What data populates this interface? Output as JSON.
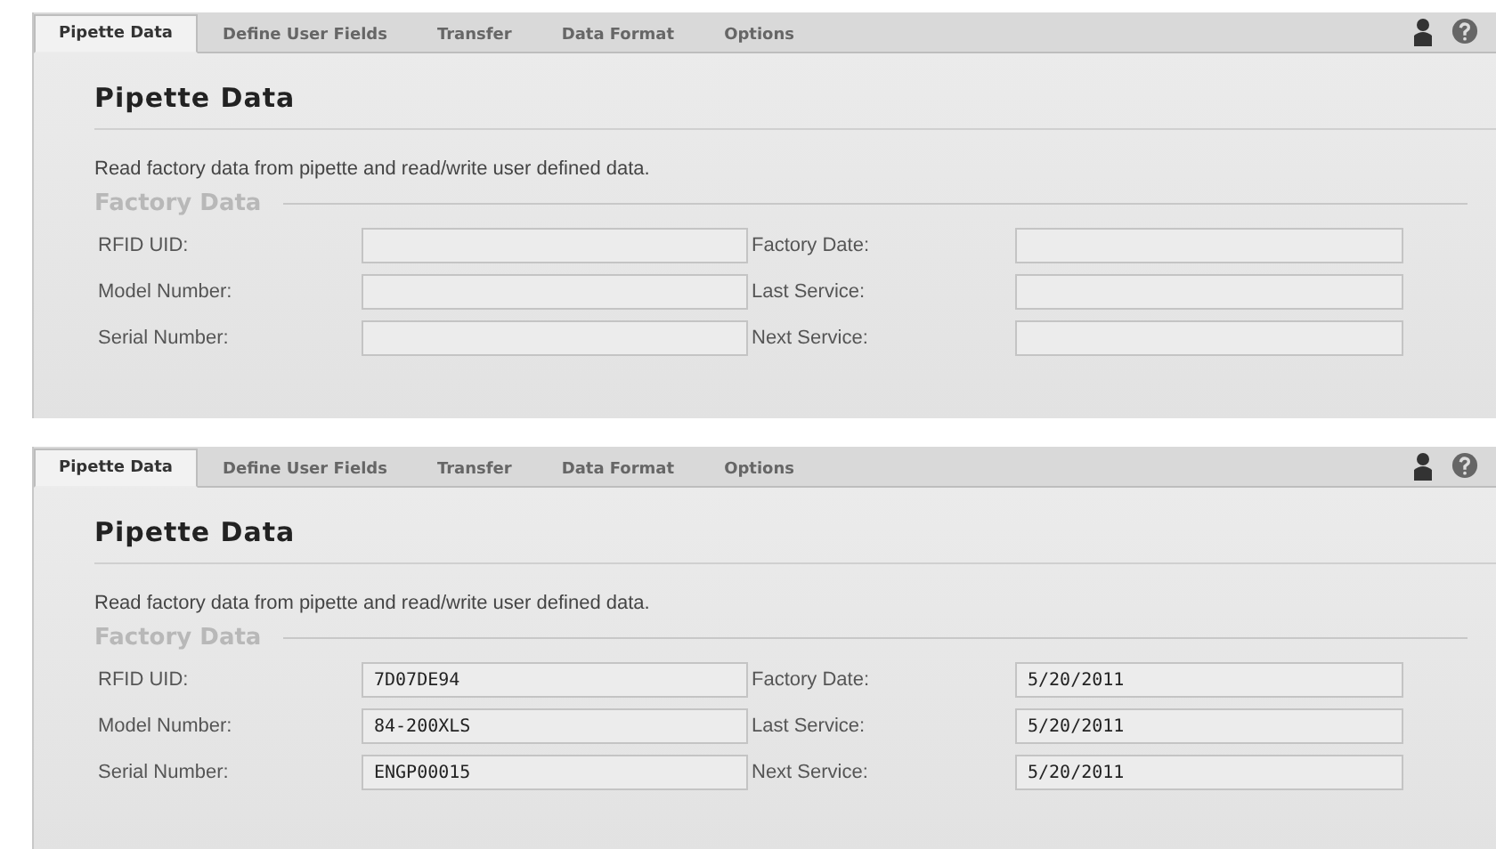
{
  "panels": [
    {
      "tabs": [
        {
          "label": "Pipette Data",
          "selected": true
        },
        {
          "label": "Define User Fields",
          "selected": false
        },
        {
          "label": "Transfer",
          "selected": false
        },
        {
          "label": "Data Format",
          "selected": false
        },
        {
          "label": "Options",
          "selected": false
        }
      ],
      "title": "Pipette Data",
      "description": "Read factory data from pipette and read/write user defined data.",
      "section": "Factory Data",
      "fields": [
        {
          "label": "RFID UID:"
        },
        {
          "label": "Factory Date:"
        },
        {
          "label": "Model Number:"
        },
        {
          "label": "Last Service:"
        },
        {
          "label": "Serial Number:"
        },
        {
          "label": "Next Service:"
        }
      ]
    },
    {
      "tabs": [
        {
          "label": "Pipette Data",
          "selected": true
        },
        {
          "label": "Define User Fields",
          "selected": false
        },
        {
          "label": "Transfer",
          "selected": false
        },
        {
          "label": "Data Format",
          "selected": false
        },
        {
          "label": "Options",
          "selected": false
        }
      ],
      "title": "Pipette Data",
      "description": "Read factory data from pipette and read/write user defined data.",
      "section": "Factory Data",
      "fields": [
        {
          "label": "RFID UID:",
          "value": "7D07DE94"
        },
        {
          "label": "Factory Date:",
          "value": "5/20/2011"
        },
        {
          "label": "Model Number:",
          "value": "84-200XLS"
        },
        {
          "label": "Last Service:",
          "value": "5/20/2011"
        },
        {
          "label": "Serial Number:",
          "value": "ENGP00015"
        },
        {
          "label": "Next Service:",
          "value": "5/20/2011"
        }
      ]
    }
  ]
}
